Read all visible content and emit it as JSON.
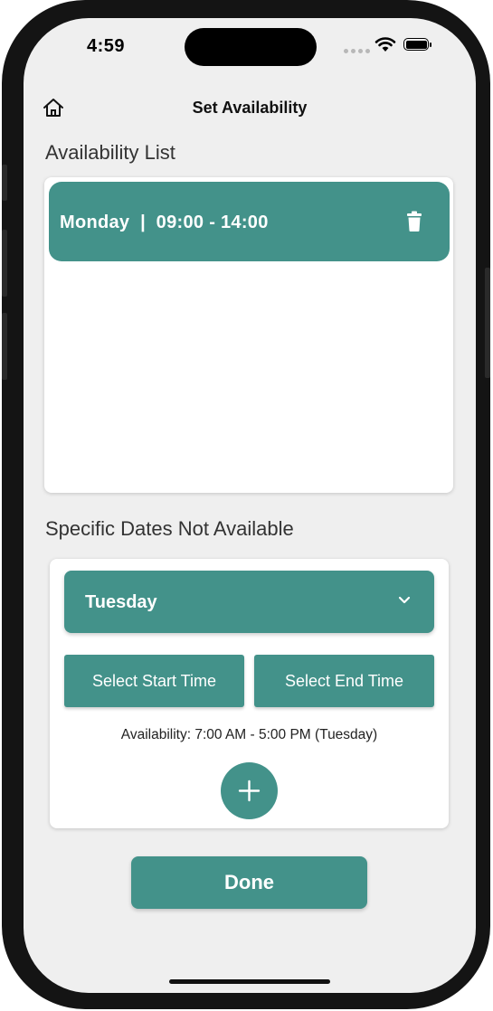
{
  "status_bar": {
    "time": "4:59"
  },
  "nav": {
    "title": "Set Availability",
    "home_icon": "home-icon"
  },
  "availability_list": {
    "title": "Availability List",
    "items": [
      {
        "text": "Monday  |  09:00 - 14:00",
        "icon": "trash-icon"
      }
    ]
  },
  "specific_dates": {
    "title": "Specific Dates Not Available",
    "selected_day": "Tuesday",
    "start_button": "Select Start Time",
    "end_button": "Select End Time",
    "availability_text": "Availability: 7:00 AM - 5:00 PM (Tuesday)",
    "add_icon": "plus-icon"
  },
  "done_button": "Done",
  "colors": {
    "accent": "#43928a",
    "background": "#efefef"
  }
}
